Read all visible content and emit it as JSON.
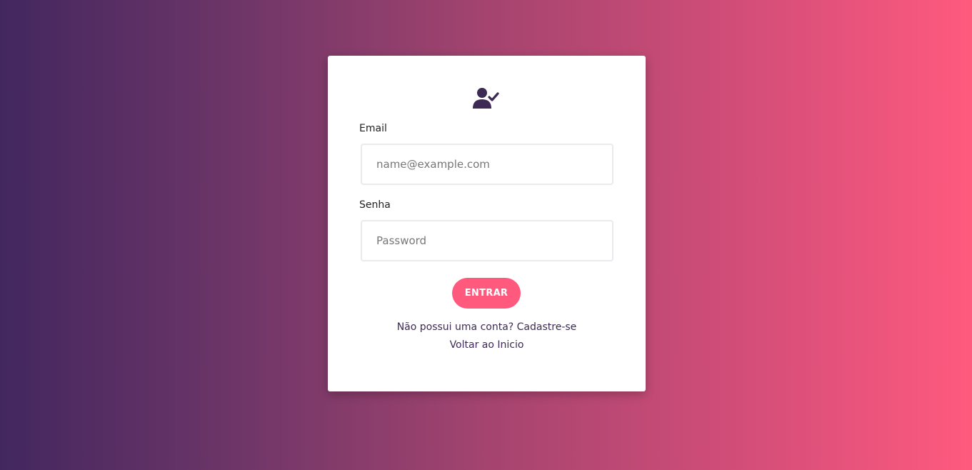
{
  "login": {
    "icon": "user-check-icon",
    "email_label": "Email",
    "email_placeholder": "name@example.com",
    "email_value": "",
    "password_label": "Senha",
    "password_placeholder": "Password",
    "password_value": "",
    "submit_label": "ENTRAR",
    "signup_link": "Não possui uma conta? Cadastre-se",
    "back_link": "Voltar ao Inicio"
  },
  "colors": {
    "accent": "#ff5a7e",
    "icon": "#3c2a55",
    "gradient_start": "#42275f",
    "gradient_end": "#ff5a7e"
  }
}
